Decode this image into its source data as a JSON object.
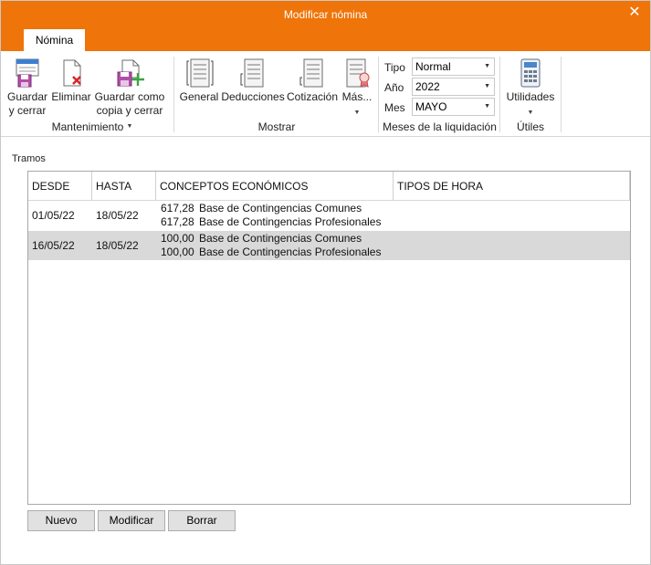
{
  "window": {
    "title": "Modificar nómina",
    "close_glyph": "✕"
  },
  "ribbon": {
    "tab": "Nómina",
    "mantenimiento": {
      "label": "Mantenimiento",
      "guardar_line1": "Guardar",
      "guardar_line2": "y cerrar",
      "eliminar": "Eliminar",
      "copia_line1": "Guardar como",
      "copia_line2": "copia y cerrar"
    },
    "mostrar": {
      "label": "Mostrar",
      "general": "General",
      "deducciones": "Deducciones",
      "cotizacion": "Cotización",
      "mas": "Más..."
    },
    "meses": {
      "label": "Meses de la liquidación",
      "tipo_label": "Tipo",
      "tipo_value": "Normal",
      "anio_label": "Año",
      "anio_value": "2022",
      "mes_label": "Mes",
      "mes_value": "MAYO"
    },
    "utiles": {
      "label": "Útiles",
      "utilidades": "Utilidades"
    }
  },
  "tramos": {
    "title": "Tramos",
    "columns": [
      "DESDE",
      "HASTA",
      "CONCEPTOS ECONÓMICOS",
      "TIPOS DE HORA"
    ],
    "rows": [
      {
        "desde": "01/05/22",
        "hasta": "18/05/22",
        "conceptos": [
          {
            "amount": "617,28",
            "name": "Base de Contingencias Comunes"
          },
          {
            "amount": "617,28",
            "name": "Base de Contingencias Profesionales"
          }
        ],
        "tipos_hora": ""
      },
      {
        "desde": "16/05/22",
        "hasta": "18/05/22",
        "conceptos": [
          {
            "amount": "100,00",
            "name": "Base de Contingencias Comunes"
          },
          {
            "amount": "100,00",
            "name": "Base de Contingencias Profesionales"
          }
        ],
        "tipos_hora": ""
      }
    ]
  },
  "buttons": {
    "nuevo": "Nuevo",
    "modificar": "Modificar",
    "borrar": "Borrar"
  },
  "colors": {
    "title_bar": "#ef7409",
    "selected_row": "#d9d9d9",
    "button_face": "#e1e1e1"
  },
  "icons": {
    "guardar": "save-close-icon",
    "eliminar": "delete-icon",
    "copia": "save-copy-icon",
    "general": "general-sheet-icon",
    "deducciones": "deductions-sheet-icon",
    "cotizacion": "contribution-sheet-icon",
    "mas": "more-sheet-icon",
    "utilidades": "calculator-icon"
  }
}
